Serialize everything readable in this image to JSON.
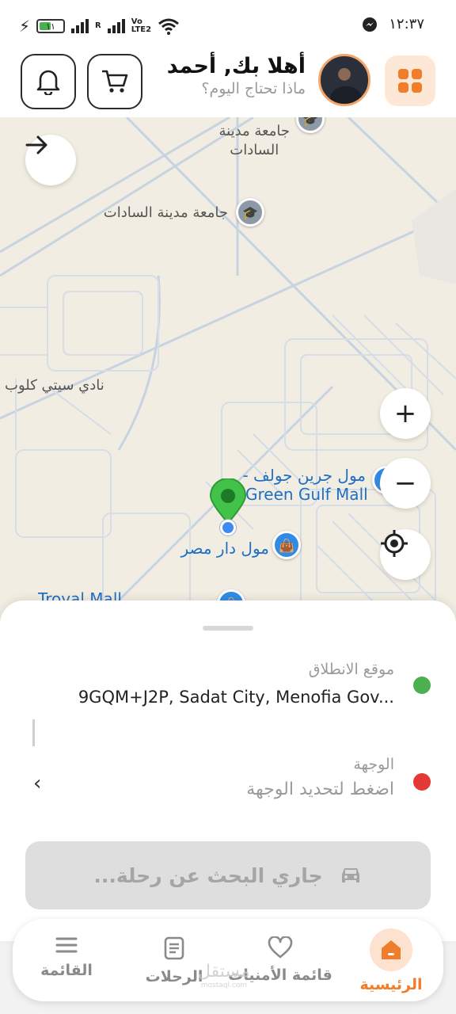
{
  "status_bar": {
    "battery": "١١",
    "network_r": "R",
    "volte_top": "Vo",
    "volte_bottom": "LTE2",
    "time": "١٢:٣٧"
  },
  "header": {
    "greeting": "أهلا بك, أحمد",
    "subtitle": "ماذا تحتاج اليوم؟",
    "accent_color": "#f07d2a"
  },
  "map": {
    "labels": {
      "university_top_line1": "جامعة مدينة",
      "university_top_line2": "السادات",
      "university_main": "جامعة مدينة السادات",
      "club": "نادي سيتي كلوب",
      "green_gulf_ar": "مول جرين جولف -",
      "green_gulf_en": "Green Gulf Mall",
      "dar_misr": "مول دار مصر",
      "troyal": "Troyal Mall"
    },
    "controls": {
      "zoom_in": "+",
      "zoom_out": "−"
    }
  },
  "trip": {
    "pickup_label": "موقع الانطلاق",
    "pickup_value": "9GQM+J2P, Sadat City, Menofia Gov...",
    "destination_label": "الوجهة",
    "destination_placeholder": "اضغط لتحديد الوجهة",
    "pickup_color": "#4caf50",
    "destination_color": "#e53935",
    "search_button": "جاري البحث عن رحلة..."
  },
  "bottom_nav": {
    "home": "الرئيسية",
    "wishlist": "قائمة الأمنيات",
    "trips": "الرحلات",
    "menu": "القائمة"
  },
  "watermark": {
    "main": "مستقل",
    "sub": "mostaql.com"
  }
}
